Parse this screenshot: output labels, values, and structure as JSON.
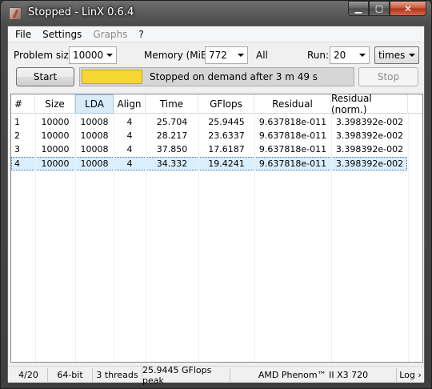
{
  "window": {
    "title": "Stopped - LinX 0.6.4",
    "buttons": {
      "minimize": "▁",
      "maximize": "▢",
      "close": "✕"
    }
  },
  "menu": [
    {
      "label": "File",
      "enabled": true
    },
    {
      "label": "Settings",
      "enabled": true
    },
    {
      "label": "Graphs",
      "enabled": false
    },
    {
      "label": "?",
      "enabled": true
    }
  ],
  "controls": {
    "problem_size_label": "Problem size:",
    "problem_size_value": "10000",
    "memory_label": "Memory (MiB):",
    "memory_value": "772",
    "all_label": "All",
    "run_label": "Run:",
    "run_value": "20",
    "run_unit": "times"
  },
  "actions": {
    "start_label": "Start",
    "stop_label": "Stop",
    "status_message": "Stopped on demand after 3 m 49 s",
    "status_color": "#f5d833"
  },
  "table": {
    "columns": [
      "#",
      "Size",
      "LDA",
      "Align",
      "Time",
      "GFlops",
      "Residual",
      "Residual (norm.)"
    ],
    "rows": [
      [
        "1",
        "10000",
        "10008",
        "4",
        "25.704",
        "25.9445",
        "9.637818e-011",
        "3.398392e-002"
      ],
      [
        "2",
        "10000",
        "10008",
        "4",
        "28.217",
        "23.6337",
        "9.637818e-011",
        "3.398392e-002"
      ],
      [
        "3",
        "10000",
        "10008",
        "4",
        "37.850",
        "17.6187",
        "9.637818e-011",
        "3.398392e-002"
      ],
      [
        "4",
        "10000",
        "10008",
        "4",
        "34.332",
        "19.4241",
        "9.637818e-011",
        "3.398392e-002"
      ]
    ],
    "selected_row": 4,
    "sorted_column": "LDA"
  },
  "statusbar": {
    "progress": "4/20",
    "bits": "64-bit",
    "threads": "3 threads",
    "peak": "25.9445 GFlops peak",
    "cpu": "AMD Phenom™ II X3 720",
    "log": "Log ›"
  }
}
